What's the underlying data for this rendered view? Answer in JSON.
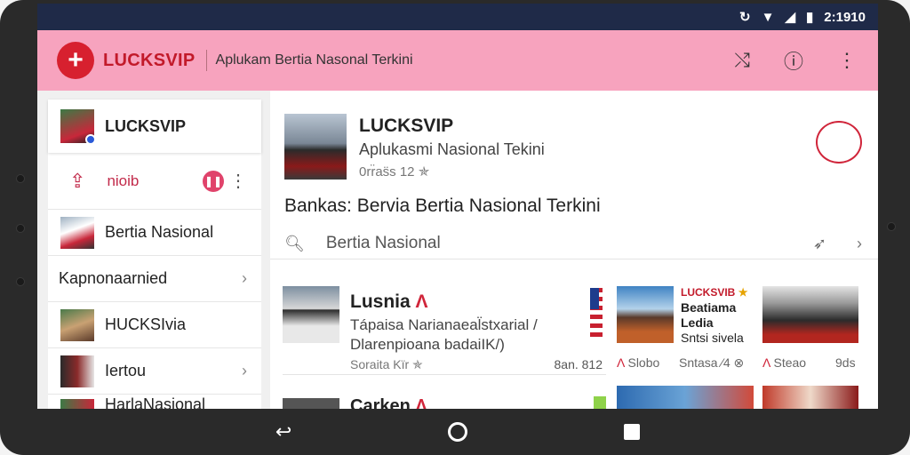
{
  "status_bar": {
    "clock": "2:1910",
    "icons": [
      "sync-icon",
      "wifi-icon",
      "signal-icon",
      "battery-icon"
    ]
  },
  "app_bar": {
    "logo_glyph": "+",
    "brand": "LUCKSVIP",
    "subtitle": "Aplukam Bertia Nasonal Terkini",
    "actions": [
      "shuffle-icon",
      "info-icon",
      "more-vert-icon"
    ]
  },
  "sidebar": {
    "profile_name": "LUCKSVIP",
    "action_label": "nioib",
    "items": [
      {
        "label": "Bertia Nasional",
        "has_chevron": false
      },
      {
        "label": "Kapnonaarnied",
        "has_chevron": true
      },
      {
        "label": "HUCKSIvia",
        "has_chevron": false
      },
      {
        "label": "Iertou",
        "has_chevron": true
      },
      {
        "label": "HarlaNasional",
        "has_chevron": false
      }
    ]
  },
  "post": {
    "title": "LUCKSVIP",
    "subtitle": "Aplukasmi Nasional Tekini",
    "meta": "0rr̈as̈s 12 ✯",
    "headline": "Bankas: Bervia Bertia Nasional Terkini",
    "search_label": "Bertia Nasional"
  },
  "news": {
    "card1": {
      "title": "Lusnia",
      "title_accent": "Λ",
      "line1": "Tápaisa Narianaeal̈stxarial /",
      "line2": "Dlarenpioana badaiIK/)",
      "source": "Soraita Kïr ✯",
      "time": "8an. 812"
    },
    "card2": {
      "title": "Carken",
      "title_accent": "Λ"
    },
    "card3": {
      "brand": "LUCKSVIB",
      "line1": "Beatiama",
      "line2": "Ledia",
      "line3": "Sntsi sivela",
      "source_accent": "Λ",
      "source": "Slobo",
      "time": "Sntasa ⁄4 ⊗"
    },
    "card4": {
      "source_accent": "Λ",
      "source": "Steao",
      "time": "9ds"
    }
  },
  "colors": {
    "status_bar": "#1f2a48",
    "app_bar": "#f7a3be",
    "brand_red": "#d7202f",
    "accent": "#d0253a"
  }
}
